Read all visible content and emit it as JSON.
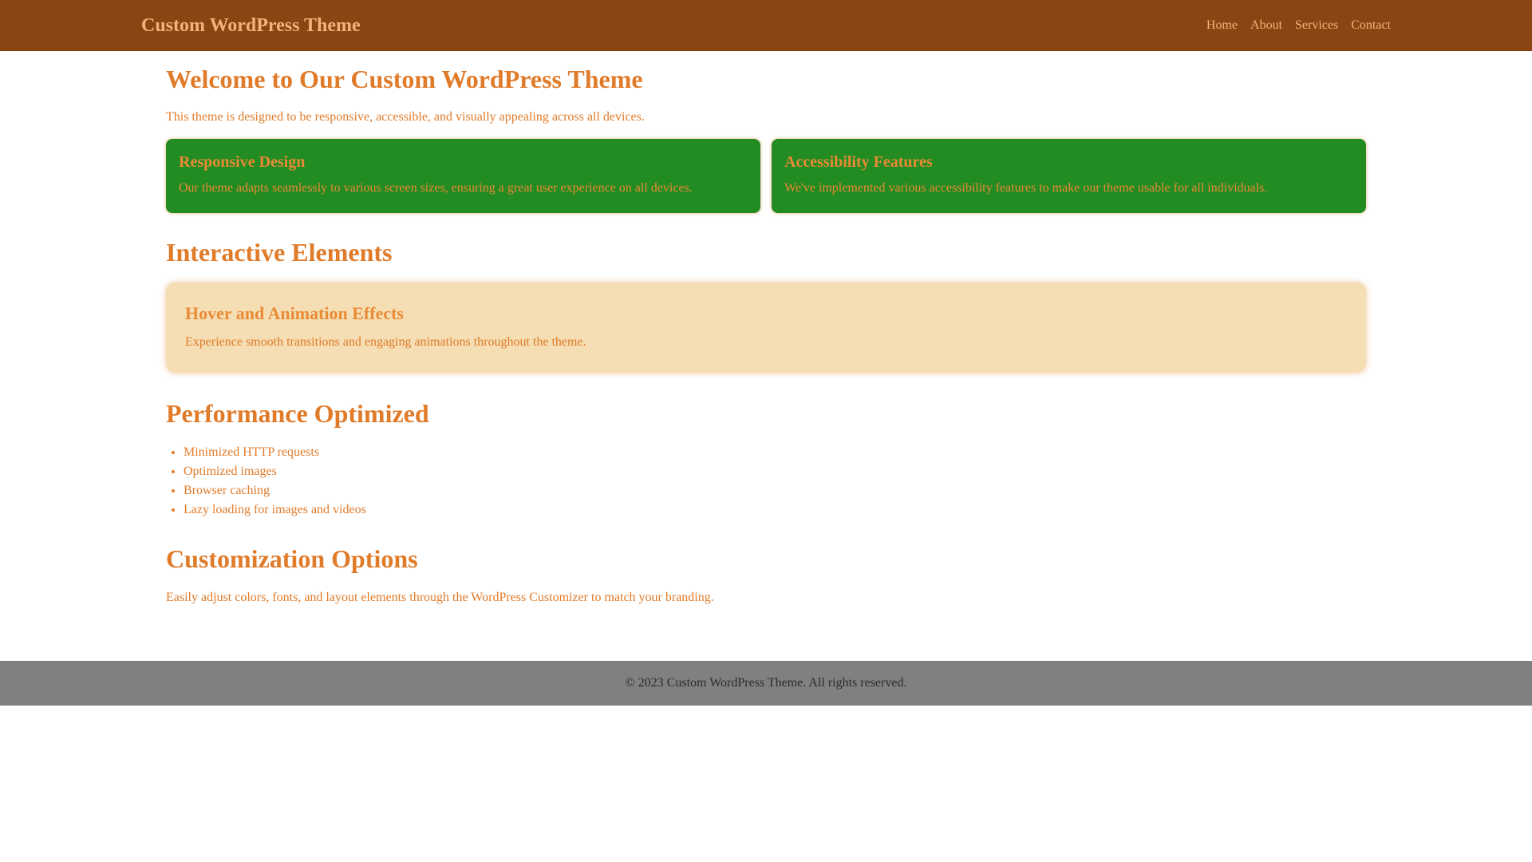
{
  "header": {
    "site_title": "Custom WordPress Theme",
    "nav": [
      "Home",
      "About",
      "Services",
      "Contact"
    ]
  },
  "intro": {
    "title": "Welcome to Our Custom WordPress Theme",
    "text": "This theme is designed to be responsive, accessible, and visually appealing across all devices."
  },
  "features": [
    {
      "title": "Responsive Design",
      "text": "Our theme adapts seamlessly to various screen sizes, ensuring a great user experience on all devices."
    },
    {
      "title": "Accessibility Features",
      "text": "We've implemented various accessibility features to make our theme usable for all individuals."
    }
  ],
  "interactive": {
    "heading": "Interactive Elements",
    "card_title": "Hover and Animation Effects",
    "card_text": "Experience smooth transitions and engaging animations throughout the theme."
  },
  "performance": {
    "heading": "Performance Optimized",
    "items": [
      "Minimized HTTP requests",
      "Optimized images",
      "Browser caching",
      "Lazy loading for images and videos"
    ]
  },
  "customization": {
    "heading": "Customization Options",
    "text": "Easily adjust colors, fonts, and layout elements through the WordPress Customizer to match your branding."
  },
  "footer": {
    "text": "© 2023 Custom WordPress Theme. All rights reserved."
  },
  "colors": {
    "header_bg": "#8b4513",
    "accent_text": "#e07b2a",
    "feature_card_bg": "#228b22",
    "interactive_card_bg": "#f5deb3",
    "footer_bg": "#808080"
  }
}
